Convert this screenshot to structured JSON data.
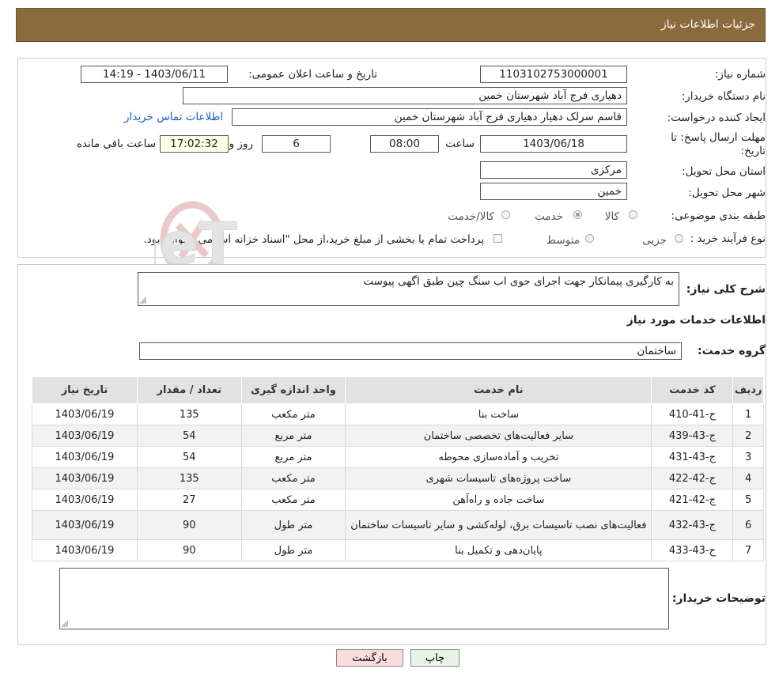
{
  "header": {
    "title": "جزئیات اطلاعات نیاز"
  },
  "form": {
    "need_number_label": "شماره نیاز:",
    "need_number": "1103102753000001",
    "announce_label": "تاریخ و ساعت اعلان عمومی:",
    "announce_value": "1403/06/11 - 14:19",
    "buyer_org_label": "نام دستگاه خریدار:",
    "buyer_org": "دهیاری فرج آباد شهرستان خمین",
    "creator_label": "ایجاد کننده درخواست:",
    "creator": "قاسم سرلک دهیار دهیاری فرج آباد شهرستان خمین",
    "contact_link": "اطلاعات تماس خریدار",
    "deadline_label_1": "مهلت ارسال پاسخ: تا",
    "deadline_label_2": "تاریخ:",
    "deadline_date": "1403/06/18",
    "time_label": "ساعت",
    "deadline_time": "08:00",
    "days": "6",
    "days_label": "روز و",
    "timer": "17:02:32",
    "remaining_label": "ساعت باقی مانده",
    "province_label": "استان محل تحویل:",
    "province": "مرکزی",
    "city_label": "شهر محل تحویل:",
    "city": "خمین",
    "category_label": "طبقه بندی موضوعی:",
    "category_options": [
      "کالا",
      "خدمت",
      "کالا/خدمت"
    ],
    "category_selected": "خدمت",
    "process_label": "نوع فرآیند خرید :",
    "process_options": [
      "جزیی",
      "متوسط"
    ],
    "payment_note": "پرداخت تمام یا بخشی از مبلغ خرید،از محل \"اسناد خزانه اسلامی\" خواهد بود."
  },
  "description": {
    "label": "شرح کلی نیاز:",
    "value": "به کارگیری پیمانکار جهت اجرای جوی اب سنگ چین طبق اگهی پیوست"
  },
  "services": {
    "section_title": "اطلاعات خدمات مورد نیاز",
    "group_label": "گروه خدمت:",
    "group_value": "ساختمان",
    "columns": [
      "ردیف",
      "کد خدمت",
      "نام خدمت",
      "واحد اندازه گیری",
      "تعداد / مقدار",
      "تاریخ نیاز"
    ],
    "rows": [
      {
        "idx": "1",
        "code": "ج-41-410",
        "name": "ساخت بنا",
        "unit": "متر مکعب",
        "qty": "135",
        "date": "1403/06/19"
      },
      {
        "idx": "2",
        "code": "ج-43-439",
        "name": "سایر فعالیت‌های تخصصی ساختمان",
        "unit": "متر مربع",
        "qty": "54",
        "date": "1403/06/19"
      },
      {
        "idx": "3",
        "code": "ج-43-431",
        "name": "تخریب و آماده‌سازی محوطه",
        "unit": "متر مربع",
        "qty": "54",
        "date": "1403/06/19"
      },
      {
        "idx": "4",
        "code": "ج-42-422",
        "name": "ساخت پروژه‌های تاسیسات شهری",
        "unit": "متر مکعب",
        "qty": "135",
        "date": "1403/06/19"
      },
      {
        "idx": "5",
        "code": "ج-42-421",
        "name": "ساخت جاده و راه‌آهن",
        "unit": "متر مکعب",
        "qty": "27",
        "date": "1403/06/19"
      },
      {
        "idx": "6",
        "code": "ج-43-432",
        "name": "فعالیت‌های نصب تاسیسات برق، لوله‌کشی و سایر تاسیسات ساختمان",
        "unit": "متر طول",
        "qty": "90",
        "date": "1403/06/19"
      },
      {
        "idx": "7",
        "code": "ج-43-433",
        "name": "پایان‌دهی و تکمیل بنا",
        "unit": "متر طول",
        "qty": "90",
        "date": "1403/06/19"
      }
    ]
  },
  "buyer_notes": {
    "label": "توضیحات خریدار:",
    "value": ""
  },
  "buttons": {
    "print": "چاپ",
    "back": "بازگشت"
  },
  "watermark": {
    "text": "AriaTender.neT"
  },
  "colors": {
    "header_bg": "#8b6a3e",
    "link": "#1d5cc8",
    "back_button": "#f9dcdc",
    "print_button": "#e7f6e4"
  }
}
